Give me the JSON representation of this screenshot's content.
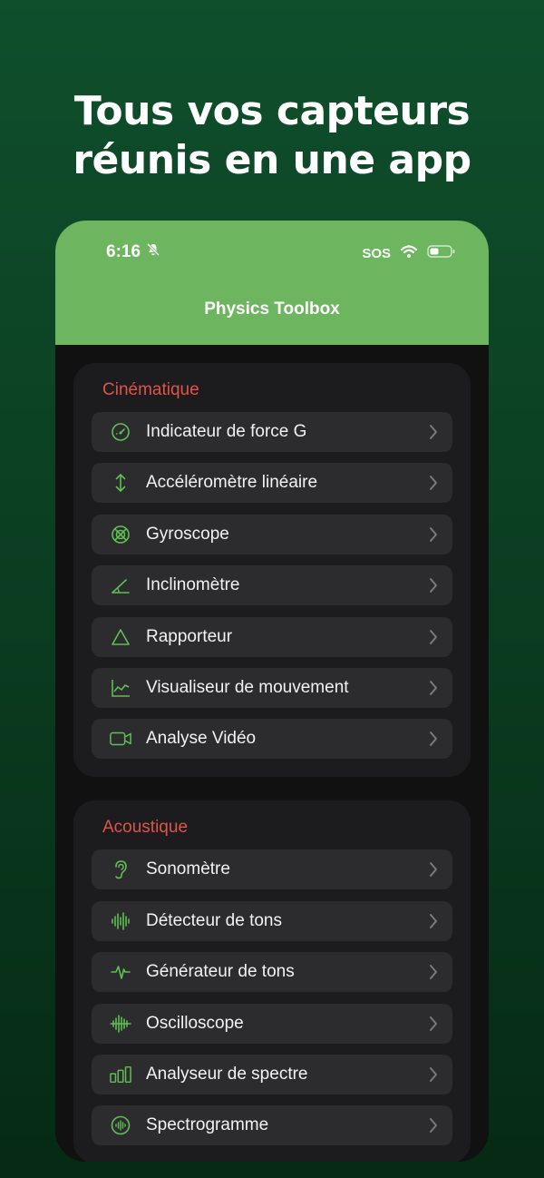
{
  "headline": {
    "line1": "Tous vos capteurs",
    "line2": "réunis en une app"
  },
  "status_bar": {
    "time": "6:16",
    "sos": "SOS"
  },
  "app": {
    "title": "Physics Toolbox"
  },
  "colors": {
    "accent": "#6db55f",
    "section_title": "#e0534a",
    "icon": "#5fbf55"
  },
  "sections": [
    {
      "title": "Cinématique",
      "items": [
        {
          "label": "Indicateur de force G",
          "icon": "gauge-icon"
        },
        {
          "label": "Accéléromètre linéaire",
          "icon": "up-down-arrow-icon"
        },
        {
          "label": "Gyroscope",
          "icon": "gyroscope-icon"
        },
        {
          "label": "Inclinomètre",
          "icon": "angle-icon"
        },
        {
          "label": "Rapporteur",
          "icon": "triangle-icon"
        },
        {
          "label": "Visualiseur de mouvement",
          "icon": "line-chart-icon"
        },
        {
          "label": "Analyse Vidéo",
          "icon": "video-camera-icon"
        }
      ]
    },
    {
      "title": "Acoustique",
      "items": [
        {
          "label": "Sonomètre",
          "icon": "ear-icon"
        },
        {
          "label": "Détecteur de tons",
          "icon": "waveform-icon"
        },
        {
          "label": "Générateur de tons",
          "icon": "pulse-icon"
        },
        {
          "label": "Oscilloscope",
          "icon": "oscilloscope-icon"
        },
        {
          "label": "Analyseur de spectre",
          "icon": "spectrum-bars-icon"
        },
        {
          "label": "Spectrogramme",
          "icon": "spectrogram-icon"
        }
      ]
    }
  ]
}
